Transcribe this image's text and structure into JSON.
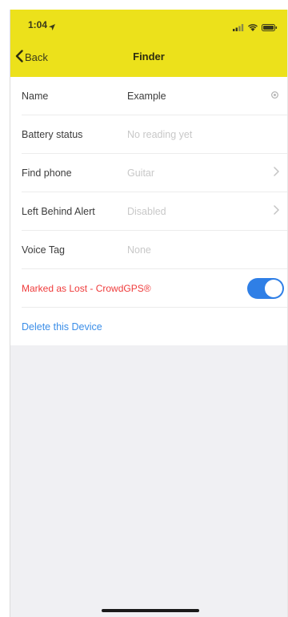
{
  "status_bar": {
    "time": "1:04"
  },
  "nav": {
    "back_label": "Back",
    "title": "Finder"
  },
  "rows": [
    {
      "label": "Name",
      "value": "Example"
    },
    {
      "label": "Battery status",
      "value": "No reading yet"
    },
    {
      "label": "Find phone",
      "value": "Guitar"
    },
    {
      "label": "Left Behind Alert",
      "value": "Disabled"
    },
    {
      "label": "Voice Tag",
      "value": "None"
    }
  ],
  "lost": {
    "label": "Marked as Lost - CrowdGPS®",
    "enabled": true
  },
  "delete": {
    "label": "Delete this Device"
  },
  "colors": {
    "header": "#ece11b",
    "accent_blue": "#2f7fe6",
    "danger_red": "#ef3b3b",
    "background": "#f0f0f3"
  },
  "icons": {
    "back": "chevron-left-icon",
    "name_row": "settings-icon",
    "disclosure": "chevron-right-icon"
  }
}
